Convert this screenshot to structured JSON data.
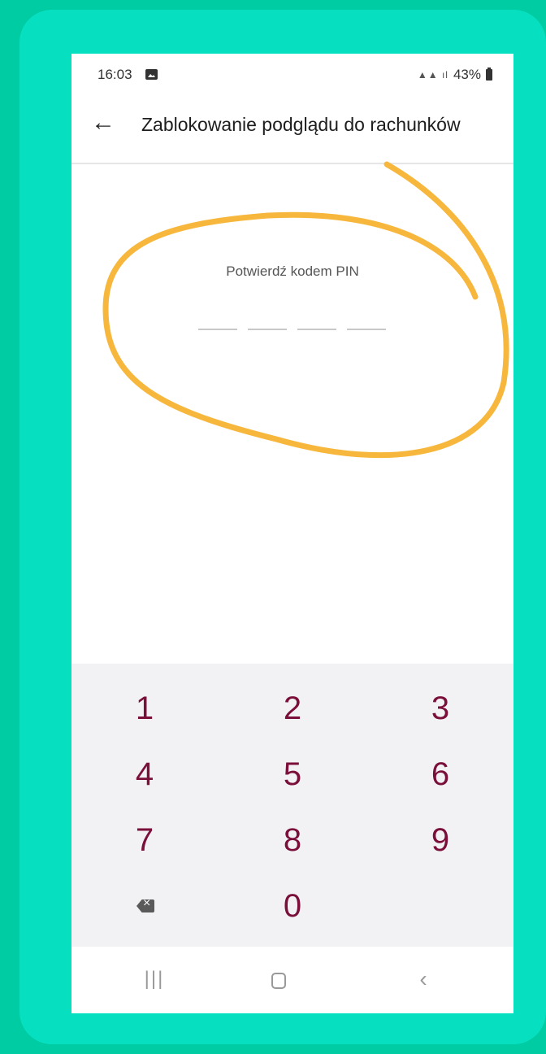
{
  "status_bar": {
    "time": "16:03",
    "network": "LTE",
    "battery": "43%"
  },
  "app_bar": {
    "title": "Zablokowanie podglądu do rachunków"
  },
  "pin": {
    "label": "Potwierdź kodem PIN",
    "digits_entered": 0,
    "slots": 4
  },
  "keypad": {
    "keys": [
      "1",
      "2",
      "3",
      "4",
      "5",
      "6",
      "7",
      "8",
      "9",
      "0"
    ]
  },
  "icons": {
    "back": "arrow-left-icon",
    "backspace": "backspace-icon",
    "recents": "recents-icon",
    "home": "home-icon",
    "nav_back": "chevron-left-icon"
  },
  "colors": {
    "background": "#00cca4",
    "frame": "#07e0c0",
    "keypad_digits": "#7a0f3a",
    "annotation": "#f6b73c"
  }
}
